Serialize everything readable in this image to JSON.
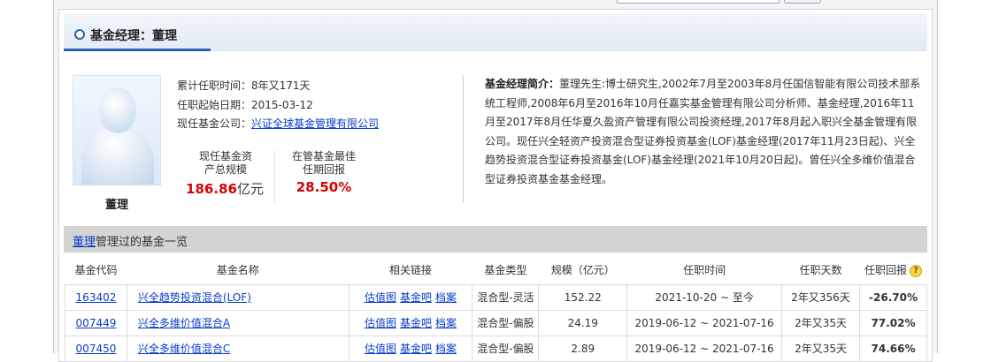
{
  "header": {
    "title": "基金经理：董理"
  },
  "manager": {
    "name": "董理",
    "tenure_label": "累计任职时间：",
    "tenure_value": "8年又171天",
    "start_label": "任职起始日期：",
    "start_value": "2015-03-12",
    "company_label": "现任基金公司：",
    "company_value": "兴证全球基金管理有限公司",
    "stats": [
      {
        "label": "现任基金资产总规模",
        "value": "186.86",
        "unit": "亿元"
      },
      {
        "label": "在管基金最佳任期回报",
        "value": "28.50%",
        "unit": ""
      }
    ],
    "intro_label": "基金经理简介：",
    "intro_text": "董理先生:博士研究生,2002年7月至2003年8月任国信智能有限公司技术部系统工程师,2008年6月至2016年10月任嘉实基金管理有限公司分析师、基金经理,2016年11月至2017年8月任华夏久盈资产管理有限公司投资经理,2017年8月起入职兴全基金管理有限公司。现任兴全轻资产投资混合型证券投资基金(LOF)基金经理(2017年11月23日起)、兴全趋势投资混合型证券投资基金(LOF)基金经理(2021年10月20日起)。曾任兴全多维价值混合型证券投资基金基金经理。"
  },
  "fund_list": {
    "title_link": "董理",
    "title_suffix": "管理过的基金一览",
    "columns": [
      "基金代码",
      "基金名称",
      "相关链接",
      "基金类型",
      "规模（亿元）",
      "任职时间",
      "任职天数",
      "任职回报"
    ],
    "link_labels": [
      "估值图",
      "基金吧",
      "档案"
    ],
    "help_icon": "?",
    "rows": [
      {
        "code": "163402",
        "name": "兴全趋势投资混合(LOF)",
        "type": "混合型-灵活",
        "scale": "152.22",
        "period": "2021-10-20 ~ 至今",
        "days": "2年又356天",
        "return": "-26.70%"
      },
      {
        "code": "007449",
        "name": "兴全多维价值混合A",
        "type": "混合型-偏股",
        "scale": "24.19",
        "period": "2019-06-12 ~ 2021-07-16",
        "days": "2年又35天",
        "return": "77.02%"
      },
      {
        "code": "007450",
        "name": "兴全多维价值混合C",
        "type": "混合型-偏股",
        "scale": "2.89",
        "period": "2019-06-12 ~ 2021-07-16",
        "days": "2年又35天",
        "return": "74.66%"
      }
    ]
  },
  "colors": {
    "accent": "#2a64ad",
    "positive": "#d70000",
    "negative": "#0a8a00",
    "link": "#0a3cc9"
  }
}
